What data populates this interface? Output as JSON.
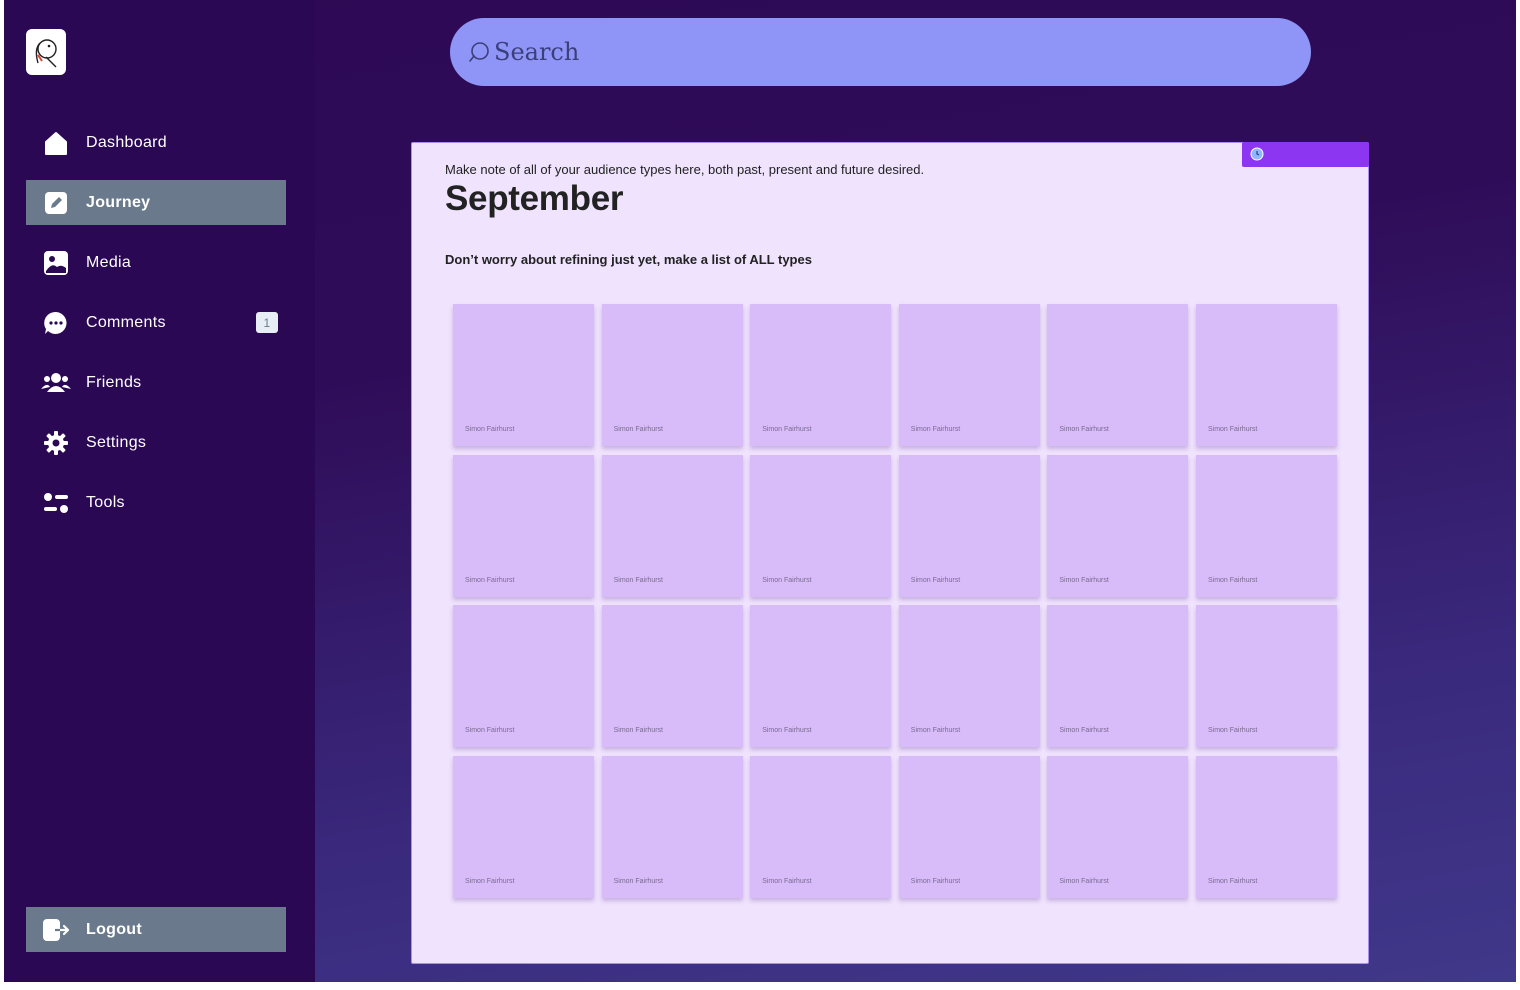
{
  "sidebar": {
    "items": [
      {
        "label": "Dashboard",
        "icon": "home-icon",
        "active": false
      },
      {
        "label": "Journey",
        "icon": "edit-icon",
        "active": true
      },
      {
        "label": "Media",
        "icon": "image-icon",
        "active": false
      },
      {
        "label": "Comments",
        "icon": "chat-icon",
        "active": false,
        "badge": "1"
      },
      {
        "label": "Friends",
        "icon": "group-icon",
        "active": false
      },
      {
        "label": "Settings",
        "icon": "gear-icon",
        "active": false
      },
      {
        "label": "Tools",
        "icon": "sliders-icon",
        "active": false
      }
    ],
    "logout_label": "Logout"
  },
  "search": {
    "placeholder": "Search"
  },
  "board": {
    "subtitle": "Make note of all of your audience types here, both past, present and future desired.",
    "title": "September",
    "prompt": "Don’t worry about refining just yet, make a list of ALL types",
    "notes": [
      "Simon Fairhurst",
      "Simon Fairhurst",
      "Simon Fairhurst",
      "Simon Fairhurst",
      "Simon Fairhurst",
      "Simon Fairhurst",
      "Simon Fairhurst",
      "Simon Fairhurst",
      "Simon Fairhurst",
      "Simon Fairhurst",
      "Simon Fairhurst",
      "Simon Fairhurst",
      "Simon Fairhurst",
      "Simon Fairhurst",
      "Simon Fairhurst",
      "Simon Fairhurst",
      "Simon Fairhurst",
      "Simon Fairhurst",
      "Simon Fairhurst",
      "Simon Fairhurst",
      "Simon Fairhurst",
      "Simon Fairhurst",
      "Simon Fairhurst",
      "Simon Fairhurst"
    ]
  },
  "colors": {
    "background": "#2e0a55",
    "sidebar": "#2a0854",
    "active_item": "#6a7a8c",
    "search": "#8f95f7",
    "board": "#f0e3fd",
    "note": "#d8bcfa",
    "accent": "#8c36f2"
  }
}
